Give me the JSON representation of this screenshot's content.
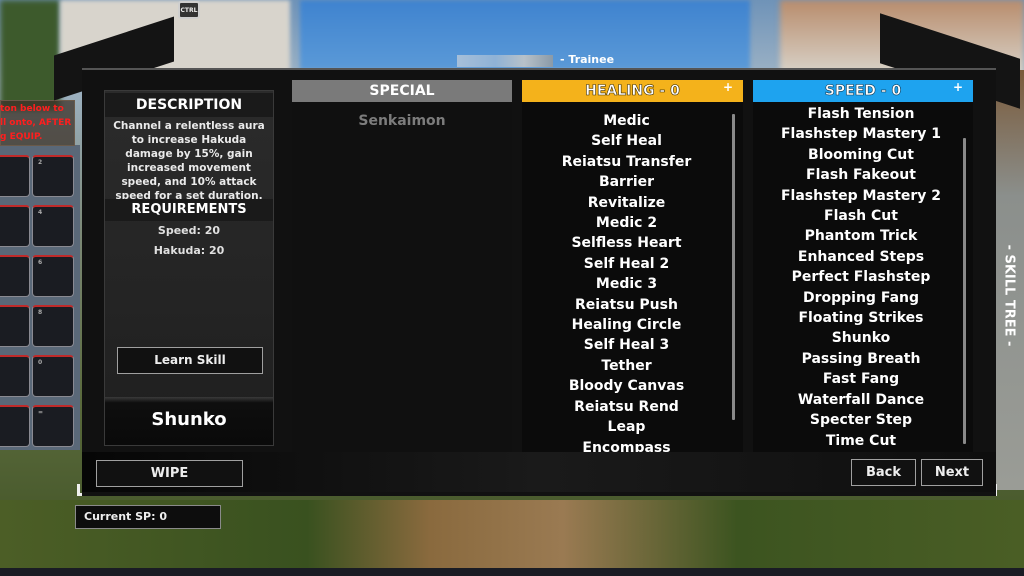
{
  "hud": {
    "ctrl_icon_label": "CTRL",
    "player_rank": "- Trainee",
    "hint_text": "ton below to\nll onto, AFTER\ng EQUIP.",
    "hotbar_slots": [
      "",
      "2",
      "",
      "4",
      "",
      "6",
      "",
      "8",
      "",
      "0",
      "",
      "="
    ],
    "current_sp": "Current SP: 0"
  },
  "description": {
    "header": "DESCRIPTION",
    "text": "Channel a relentless aura to increase Hakuda damage by 15%, gain increased movement speed, and 10% attack speed for a set duration.",
    "requirements_header": "REQUIREMENTS",
    "requirements": [
      "Speed: 20",
      "Hakuda: 20"
    ],
    "learn_button": "Learn Skill",
    "selected_skill": "Shunko"
  },
  "columns": {
    "special": {
      "header": "SPECIAL",
      "color": "#7a7a7a",
      "skills": [
        "Senkaimon"
      ]
    },
    "healing": {
      "header": "HEALING - 0",
      "color": "#f4b21b",
      "plus": "+",
      "skills": [
        "Medic",
        "Self Heal",
        "Reiatsu Transfer",
        "Barrier",
        "Revitalize",
        "Medic 2",
        "Selfless Heart",
        "Self Heal 2",
        "Medic 3",
        "Reiatsu Push",
        "Healing Circle",
        "Self Heal 3",
        "Tether",
        "Bloody Canvas",
        "Reiatsu Rend",
        "Leap",
        "Encompass"
      ]
    },
    "speed": {
      "header": "SPEED - 0",
      "color": "#1ea3ef",
      "plus": "+",
      "skills": [
        "Flash Tension",
        "Flashstep Mastery 1",
        "Blooming Cut",
        "Flash Fakeout",
        "Flashstep Mastery 2",
        "Flash Cut",
        "Phantom Trick",
        "Enhanced Steps",
        "Perfect Flashstep",
        "Dropping Fang",
        "Floating Strikes",
        "Shunko",
        "Passing Breath",
        "Fast Fang",
        "Waterfall Dance",
        "Specter Step",
        "Time Cut"
      ]
    }
  },
  "footer": {
    "wipe": "WIPE",
    "back": "Back",
    "next": "Next"
  },
  "side_tab": "- SKILL TREE -"
}
